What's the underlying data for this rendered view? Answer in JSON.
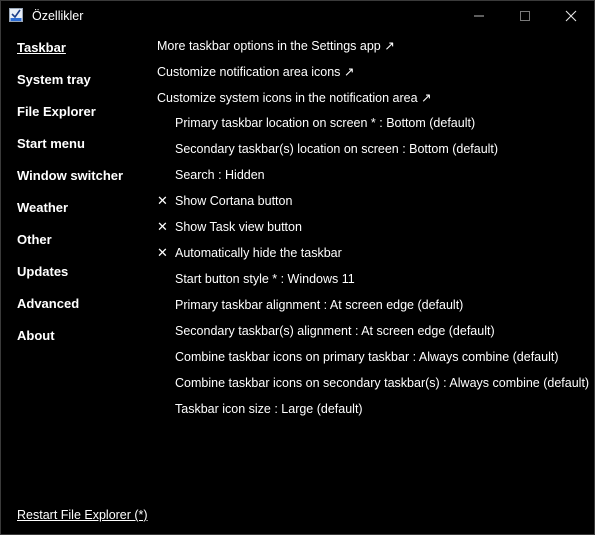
{
  "window": {
    "title": "Özellikler",
    "minimize_glyph": "—",
    "maximize_glyph": "☐",
    "close_glyph": "✕"
  },
  "sidebar": {
    "items": [
      {
        "label": "Taskbar",
        "active": true
      },
      {
        "label": "System tray"
      },
      {
        "label": "File Explorer"
      },
      {
        "label": "Start menu"
      },
      {
        "label": "Window switcher"
      },
      {
        "label": "Weather"
      },
      {
        "label": "Other"
      },
      {
        "label": "Updates"
      },
      {
        "label": "Advanced"
      },
      {
        "label": "About"
      }
    ],
    "restart_label": "Restart File Explorer (*)"
  },
  "content": {
    "links": [
      "More taskbar options in the Settings app ↗",
      "Customize notification area icons ↗",
      "Customize system icons in the notification area ↗"
    ],
    "options": [
      "Primary taskbar location on screen * : Bottom (default)",
      "Secondary taskbar(s) location on screen : Bottom (default)",
      "Search : Hidden",
      "Show Cortana button",
      "Show Task view button",
      "Automatically hide the taskbar",
      "Start button style * : Windows 11",
      "Primary taskbar alignment : At screen edge (default)",
      "Secondary taskbar(s) alignment : At screen edge (default)",
      "Combine taskbar icons on primary taskbar : Always combine (default)",
      "Combine taskbar icons on secondary taskbar(s) : Always combine (default)",
      "Taskbar icon size : Large (default)"
    ],
    "check_glyph": "✕"
  },
  "colors": {
    "background": "#000000",
    "text": "#ffffff",
    "border": "#3a3a3a"
  }
}
